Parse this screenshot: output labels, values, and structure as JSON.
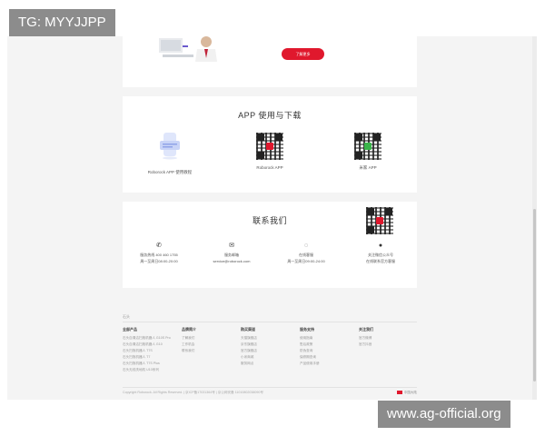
{
  "watermarks": {
    "top": "TG: MYYJJPP",
    "bottom": "www.ag-official.org"
  },
  "hero": {
    "button_label": "了解更多"
  },
  "app_section": {
    "title": "APP 使用与下载",
    "items": [
      {
        "label": "Roborock APP 使用教程",
        "icon": "phone-tutorial-icon"
      },
      {
        "label": "Roborock APP",
        "icon": "qr-code",
        "center_color": "#e0182d"
      },
      {
        "label": "米家 APP",
        "icon": "qr-code",
        "center_color": "#3ab54a"
      }
    ]
  },
  "contact_section": {
    "title": "联系我们",
    "items": [
      {
        "icon": "phone-icon",
        "title": "服务热线 400 460 1755",
        "detail": "周一至周日08:00-20:00"
      },
      {
        "icon": "mail-icon",
        "title": "服务邮箱",
        "detail": "service@roborock.com"
      },
      {
        "icon": "chat-icon",
        "title": "在线客服",
        "detail": "周一至周日09:00-24:00"
      },
      {
        "icon": "wechat-icon",
        "title": "关注微信公众号",
        "detail": "在线联系官方客服"
      }
    ]
  },
  "footer": {
    "logo": "石头",
    "columns": [
      {
        "title": "全部产品",
        "links": [
          "石头自清洁扫拖机器人 G10S Pro",
          "石头自清洁扫拖机器人 G10",
          "石头扫拖机器人 T7S",
          "石头扫拖机器人 T7",
          "石头扫拖机器人 T7S Plus",
          "石头无线洗地机 U10系列"
        ]
      },
      {
        "title": "品牌简介",
        "links": [
          "了解我们",
          "工作机会",
          "联系我们"
        ]
      },
      {
        "title": "购买渠道",
        "links": [
          "天猫旗舰店",
          "京东旗舰店",
          "官方旗舰店",
          "小米商城",
          "服务网点"
        ]
      },
      {
        "title": "服务支持",
        "links": [
          "使用指南",
          "售后政策",
          "防伪查询",
          "保修期查询",
          "产品使用手册"
        ]
      },
      {
        "title": "关注我们",
        "links": [
          "官方微博",
          "官方抖音"
        ]
      }
    ],
    "copyright": "Copyright Roborock. All Rights Reserved. | 京ICP备17031364号 | 京公网安备 11010802038090号",
    "region": "中国大陆"
  }
}
